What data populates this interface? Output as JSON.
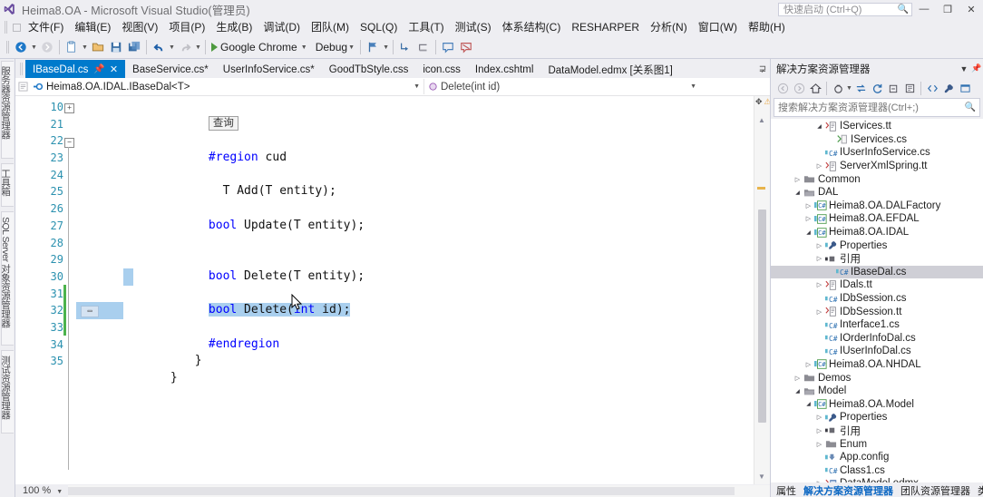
{
  "window": {
    "title": "Heima8.OA - Microsoft Visual Studio(管理员)",
    "quick_launch_placeholder": "快速启动 (Ctrl+Q)",
    "minimize_label": "—",
    "restore_label": "❐",
    "close_label": "✕",
    "accent": "#007acc"
  },
  "menu": {
    "items": [
      {
        "label": "文件(F)"
      },
      {
        "label": "编辑(E)"
      },
      {
        "label": "视图(V)"
      },
      {
        "label": "项目(P)"
      },
      {
        "label": "生成(B)"
      },
      {
        "label": "调试(D)"
      },
      {
        "label": "团队(M)"
      },
      {
        "label": "SQL(Q)"
      },
      {
        "label": "工具(T)"
      },
      {
        "label": "测试(S)"
      },
      {
        "label": "体系结构(C)"
      },
      {
        "label": "RESHARPER"
      },
      {
        "label": "分析(N)"
      },
      {
        "label": "窗口(W)"
      },
      {
        "label": "帮助(H)"
      }
    ]
  },
  "toolbar": {
    "run_target": "Google Chrome",
    "configuration": "Debug"
  },
  "left_dock": {
    "tabs": [
      {
        "label": "服务器资源管理器"
      },
      {
        "label": "工具箱"
      },
      {
        "label": "SQL Server 对象资源管理器"
      },
      {
        "label": "测试资源管理器"
      }
    ]
  },
  "editor": {
    "tabs": [
      {
        "label": "IBaseDal.cs",
        "active": true,
        "dirty": false
      },
      {
        "label": "BaseService.cs*",
        "active": false,
        "dirty": true
      },
      {
        "label": "UserInfoService.cs*",
        "active": false,
        "dirty": true
      },
      {
        "label": "GoodTbStyle.css",
        "active": false,
        "dirty": false
      },
      {
        "label": "icon.css",
        "active": false,
        "dirty": false
      },
      {
        "label": "Index.cshtml",
        "active": false,
        "dirty": false
      },
      {
        "label": "DataModel.edmx [关系图1]",
        "active": false,
        "dirty": false
      }
    ],
    "nav": {
      "type_scope": "Heima8.OA.IDAL.IBaseDal<T>",
      "member_scope": "Delete(int id)"
    },
    "collapsed_region_label": "查询",
    "zoom_level": "100 %",
    "lines": [
      {
        "number": "10",
        "tokens": [
          {
            "t": "collapsed",
            "v": "查询"
          }
        ]
      },
      {
        "number": "21",
        "tokens": []
      },
      {
        "number": "22",
        "tokens": [
          {
            "t": "pp",
            "v": "#region"
          },
          {
            "t": "plain",
            "v": " cud"
          }
        ]
      },
      {
        "number": "23",
        "tokens": []
      },
      {
        "number": "24",
        "tokens": [
          {
            "t": "plain",
            "v": "  T Add(T entity);"
          }
        ]
      },
      {
        "number": "25",
        "tokens": []
      },
      {
        "number": "26",
        "tokens": [
          {
            "t": "kw",
            "v": "bool"
          },
          {
            "t": "plain",
            "v": " Update(T entity);"
          }
        ]
      },
      {
        "number": "27",
        "tokens": []
      },
      {
        "number": "28",
        "tokens": []
      },
      {
        "number": "29",
        "tokens": [
          {
            "t": "kw",
            "v": "bool"
          },
          {
            "t": "plain",
            "v": " Delete(T entity);"
          }
        ]
      },
      {
        "number": "30",
        "tokens": []
      },
      {
        "number": "31",
        "tokens": [
          {
            "t": "kw",
            "v": "bool"
          },
          {
            "t": "plain",
            "v": " Delete("
          },
          {
            "t": "kw",
            "v": "int"
          },
          {
            "t": "plain",
            "v": " id);"
          }
        ]
      },
      {
        "number": "32",
        "tokens": []
      },
      {
        "number": "33",
        "tokens": [
          {
            "t": "pp",
            "v": "#endregion"
          }
        ]
      },
      {
        "number": "34",
        "tokens": [
          {
            "t": "plain",
            "v": " }"
          }
        ]
      },
      {
        "number": "35",
        "tokens": [
          {
            "t": "plain",
            "v": "}"
          }
        ]
      }
    ]
  },
  "solution_explorer": {
    "title": "解决方案资源管理器",
    "search_placeholder": "搜索解决方案资源管理器(Ctrl+;)",
    "tree": [
      {
        "indent": 4,
        "expander": "▲",
        "icon": "tt-file",
        "label": "IServices.tt",
        "selected": false
      },
      {
        "indent": 5,
        "expander": "",
        "icon": "cs-gen",
        "label": "IServices.cs",
        "selected": false
      },
      {
        "indent": 4,
        "expander": "",
        "icon": "cs-file",
        "label": "IUserInfoService.cs",
        "selected": false
      },
      {
        "indent": 4,
        "expander": "▶",
        "icon": "tt-file",
        "label": "ServerXmlSpring.tt",
        "selected": false
      },
      {
        "indent": 2,
        "expander": "▶",
        "icon": "folder",
        "label": "Common",
        "selected": false
      },
      {
        "indent": 2,
        "expander": "▲",
        "icon": "folder-open",
        "label": "DAL",
        "selected": false
      },
      {
        "indent": 3,
        "expander": "▶",
        "icon": "proj-cs",
        "label": "Heima8.OA.DALFactory",
        "selected": false
      },
      {
        "indent": 3,
        "expander": "▶",
        "icon": "proj-cs",
        "label": "Heima8.OA.EFDAL",
        "selected": false
      },
      {
        "indent": 3,
        "expander": "▲",
        "icon": "proj-cs",
        "label": "Heima8.OA.IDAL",
        "selected": false
      },
      {
        "indent": 4,
        "expander": "▶",
        "icon": "wrench",
        "label": "Properties",
        "selected": false
      },
      {
        "indent": 4,
        "expander": "▶",
        "icon": "refs",
        "label": "引用",
        "selected": false
      },
      {
        "indent": 5,
        "expander": "",
        "icon": "cs-file",
        "label": "IBaseDal.cs",
        "selected": true
      },
      {
        "indent": 4,
        "expander": "▶",
        "icon": "tt-file",
        "label": "IDals.tt",
        "selected": false
      },
      {
        "indent": 4,
        "expander": "",
        "icon": "cs-file",
        "label": "IDbSession.cs",
        "selected": false
      },
      {
        "indent": 4,
        "expander": "▶",
        "icon": "tt-file",
        "label": "IDbSession.tt",
        "selected": false
      },
      {
        "indent": 4,
        "expander": "",
        "icon": "cs-file",
        "label": "Interface1.cs",
        "selected": false
      },
      {
        "indent": 4,
        "expander": "",
        "icon": "cs-file",
        "label": "IOrderInfoDal.cs",
        "selected": false
      },
      {
        "indent": 4,
        "expander": "",
        "icon": "cs-file",
        "label": "IUserInfoDal.cs",
        "selected": false
      },
      {
        "indent": 3,
        "expander": "▶",
        "icon": "proj-cs",
        "label": "Heima8.OA.NHDAL",
        "selected": false
      },
      {
        "indent": 2,
        "expander": "▶",
        "icon": "folder",
        "label": "Demos",
        "selected": false
      },
      {
        "indent": 2,
        "expander": "▲",
        "icon": "folder-open",
        "label": "Model",
        "selected": false
      },
      {
        "indent": 3,
        "expander": "▲",
        "icon": "proj-cs",
        "label": "Heima8.OA.Model",
        "selected": false
      },
      {
        "indent": 4,
        "expander": "▶",
        "icon": "wrench",
        "label": "Properties",
        "selected": false
      },
      {
        "indent": 4,
        "expander": "▶",
        "icon": "refs",
        "label": "引用",
        "selected": false
      },
      {
        "indent": 4,
        "expander": "▶",
        "icon": "folder",
        "label": "Enum",
        "selected": false
      },
      {
        "indent": 4,
        "expander": "",
        "icon": "config",
        "label": "App.config",
        "selected": false
      },
      {
        "indent": 4,
        "expander": "",
        "icon": "cs-file",
        "label": "Class1.cs",
        "selected": false
      },
      {
        "indent": 4,
        "expander": "▶",
        "icon": "edmx",
        "label": "DataModel.edmx",
        "selected": false
      }
    ],
    "bottom_tabs": [
      {
        "label": "属性",
        "active": false
      },
      {
        "label": "解决方案资源管理器",
        "active": true
      },
      {
        "label": "团队资源管理器",
        "active": false
      },
      {
        "label": "类视图",
        "active": false
      }
    ]
  }
}
